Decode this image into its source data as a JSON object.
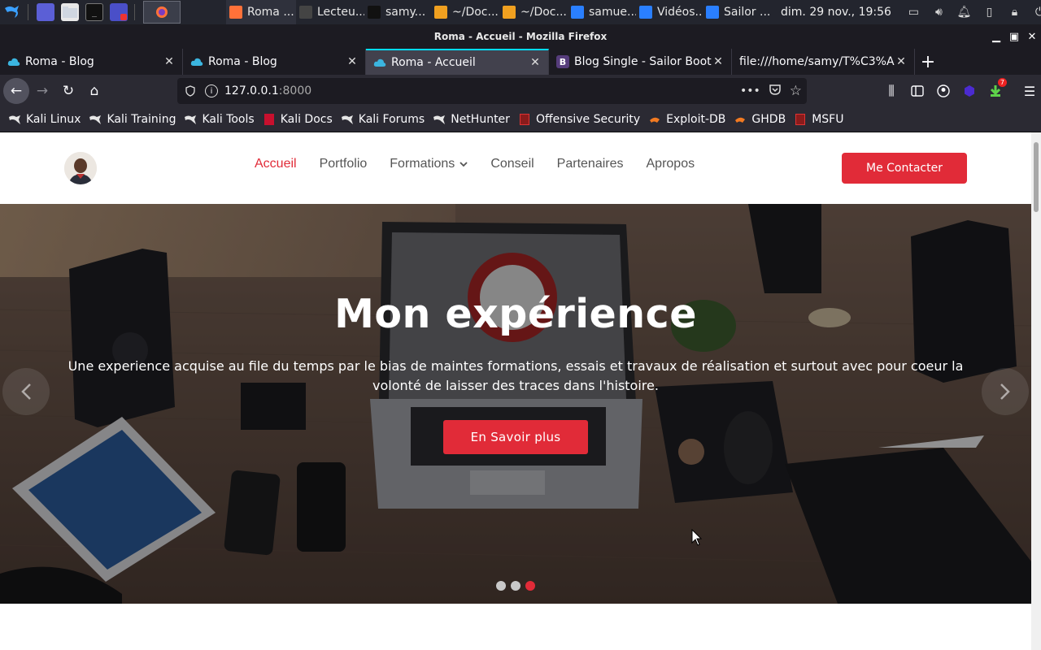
{
  "taskbar": {
    "windows": [
      {
        "label": "Roma ...",
        "color": "#ff7139"
      },
      {
        "label": "Lecteu...",
        "color": "#444"
      },
      {
        "label": "samy...",
        "color": "#111"
      },
      {
        "label": "~/Doc...",
        "color": "#f0a020"
      },
      {
        "label": "~/Doc...",
        "color": "#f0a020"
      },
      {
        "label": "samue...",
        "color": "#2a7fff"
      },
      {
        "label": "Vidéos...",
        "color": "#2a7fff"
      },
      {
        "label": "Sailor ...",
        "color": "#2a7fff"
      }
    ],
    "clock": "dim. 29 nov., 19:56"
  },
  "browser": {
    "window_title": "Roma - Accueil - Mozilla Firefox",
    "tabs": [
      {
        "title": "Roma - Blog",
        "active": false
      },
      {
        "title": "Roma - Blog",
        "active": false
      },
      {
        "title": "Roma - Accueil",
        "active": true
      },
      {
        "title": "Blog Single - Sailor Bootst",
        "active": false
      },
      {
        "title": "file:///home/samy/T%C3%A",
        "active": false
      }
    ],
    "url_host": "127.0.0.1",
    "url_port": ":8000",
    "bookmarks": [
      "Kali Linux",
      "Kali Training",
      "Kali Tools",
      "Kali Docs",
      "Kali Forums",
      "NetHunter",
      "Offensive Security",
      "Exploit-DB",
      "GHDB",
      "MSFU"
    ],
    "addon_badge": "7"
  },
  "site": {
    "nav": [
      "Accueil",
      "Portfolio",
      "Formations",
      "Conseil",
      "Partenaires",
      "Apropos"
    ],
    "contact_button": "Me Contacter",
    "accent_color": "#e12b38",
    "hero": {
      "title": "Mon expérience",
      "text": "Une experience acquise au file du temps par le bias de maintes formations, essais et travaux de réalisation et surtout avec pour coeur la volonté de laisser des traces dans l'histoire.",
      "button": "En Savoir plus",
      "slide_count": 3,
      "active_slide": 3
    }
  }
}
